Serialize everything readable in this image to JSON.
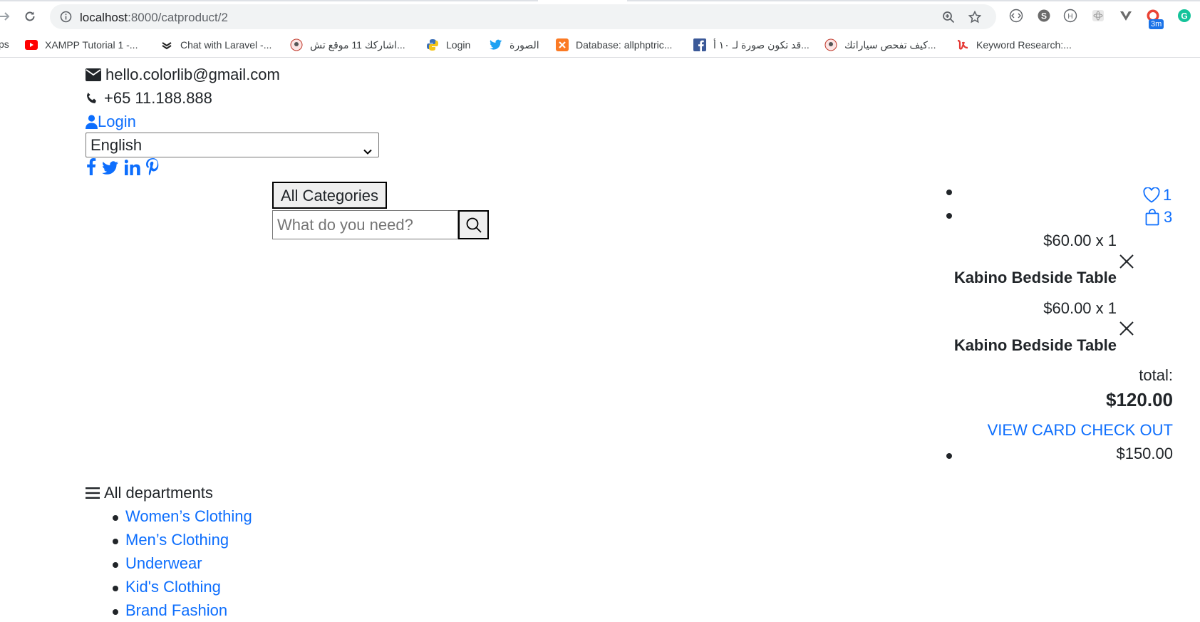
{
  "browser": {
    "url_host": "localhost",
    "url_path": ":8000/catproduct/2",
    "extension_badge": "3m",
    "bookmarks": [
      {
        "label": "ps",
        "icon": "apps-icon"
      },
      {
        "label": "XAMPP Tutorial 1 -...",
        "icon": "youtube-icon"
      },
      {
        "label": "Chat with Laravel -...",
        "icon": "chat-icon"
      },
      {
        "label": "اشاركك 11 موقع تش...",
        "icon": "avatar-icon"
      },
      {
        "label": "Login",
        "icon": "python-icon"
      },
      {
        "label": "الصورة",
        "icon": "twitter-icon"
      },
      {
        "label": "Database: allphptric...",
        "icon": "xampp-icon"
      },
      {
        "label": "قد تكون صورة لـ ١٠ أ...",
        "icon": "facebook-icon"
      },
      {
        "label": "كيف تفحص سياراتك...",
        "icon": "avatar-icon"
      },
      {
        "label": "Keyword Research:...",
        "icon": "keyword-icon"
      }
    ]
  },
  "header": {
    "email": "hello.colorlib@gmail.com",
    "phone": "+65 11.188.888",
    "login": "Login",
    "language": "English",
    "social_icons": [
      "facebook-icon",
      "twitter-icon",
      "linkedin-icon",
      "pinterest-icon"
    ]
  },
  "search": {
    "categories_button": "All Categories",
    "placeholder": "What do you need?"
  },
  "cart": {
    "wishlist_count": "1",
    "bag_count": "3",
    "items": [
      {
        "price": "$60.00 x 1",
        "name": "Kabino Bedside Table"
      },
      {
        "price": "$60.00 x 1",
        "name": "Kabino Bedside Table"
      }
    ],
    "total_label": "total:",
    "total_value": "$120.00",
    "view_card_link": "VIEW CARD",
    "checkout_link": "CHECK OUT",
    "cart_price": "$150.00"
  },
  "departments": {
    "title": "All departments",
    "items": [
      "Women’s Clothing",
      "Men’s Clothing",
      "Underwear",
      "Kid's Clothing",
      "Brand Fashion"
    ]
  },
  "colors": {
    "link": "#0d6efd",
    "text": "#212529"
  }
}
